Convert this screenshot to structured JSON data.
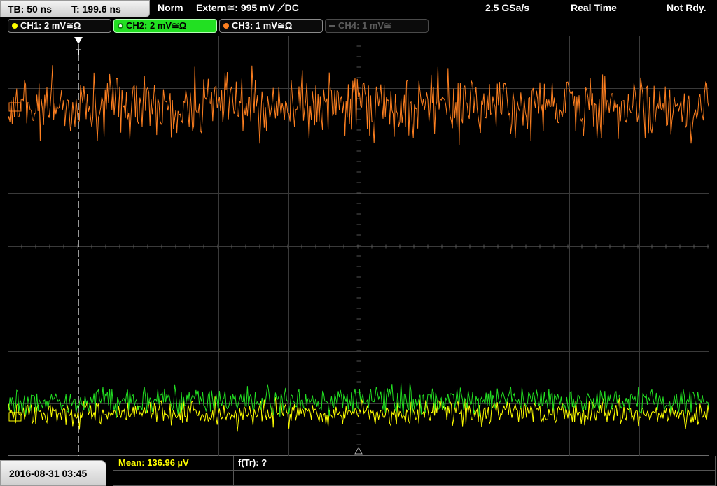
{
  "status": {
    "timebase": "TB: 50 ns",
    "trigger_time": "T: 199.6 ns",
    "mode": "Norm",
    "trigger_source": "Extern≅: 995 mV ⟋DC",
    "sample_rate": "2.5 GSa/s",
    "acquisition": "Real Time",
    "state": "Not Rdy."
  },
  "channels": [
    {
      "label": "CH1: 2 mV≅Ω",
      "color": "#ffff00",
      "state": "normal"
    },
    {
      "label": "CH2: 2 mV≅Ω",
      "color": "#22e022",
      "state": "active"
    },
    {
      "label": "CH3: 1 mV≅Ω",
      "color": "#ff8020",
      "state": "normal"
    },
    {
      "label": "CH4: 1 mV≅",
      "color": "#5c5c5c",
      "state": "disabled"
    }
  ],
  "trigger_marker": "T",
  "footer": {
    "datetime": "2016-08-31 03:45",
    "measurements": [
      {
        "label": "Mean: 136.96 µV",
        "color": "#ffff00"
      },
      {
        "label": "f(Tr): ?",
        "color": "#ffffff"
      }
    ]
  },
  "colors": {
    "ch1": "#ffff00",
    "ch2": "#22e022",
    "ch3": "#ff8020",
    "grid": "#3a3a3a"
  }
}
